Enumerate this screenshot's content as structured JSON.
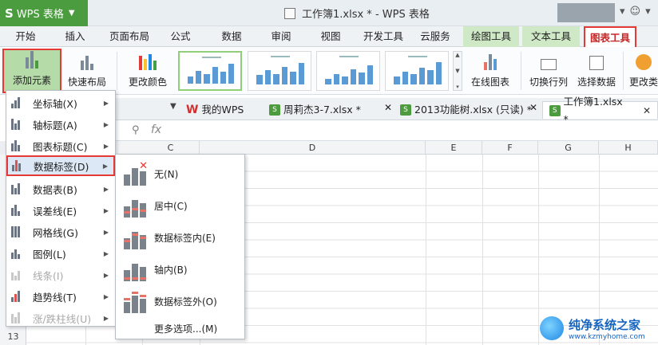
{
  "app": {
    "name": "WPS 表格",
    "logo": "S"
  },
  "title": {
    "document": "工作簿1.xlsx * - WPS 表格"
  },
  "menu_tabs": [
    {
      "label": "开始"
    },
    {
      "label": "插入"
    },
    {
      "label": "页面布局"
    },
    {
      "label": "公式"
    },
    {
      "label": "数据"
    },
    {
      "label": "审阅"
    },
    {
      "label": "视图"
    },
    {
      "label": "开发工具"
    },
    {
      "label": "云服务"
    },
    {
      "label": "绘图工具"
    },
    {
      "label": "文本工具"
    },
    {
      "label": "图表工具"
    }
  ],
  "active_tab": "图表工具",
  "ribbon": {
    "add_element": "添加元素",
    "quick_layout": "快速布局",
    "change_color": "更改颜色",
    "online_chart": "在线图表",
    "switch_row_col": "切换行列",
    "select_data": "选择数据",
    "change_type": "更改类"
  },
  "doc_tabs": [
    {
      "label": "我的WPS",
      "icon": "wps-icon",
      "closable": false
    },
    {
      "label": "周莉杰3-7.xlsx *",
      "icon": "spreadsheet-icon",
      "closable": true
    },
    {
      "label": "2013功能树.xlsx (只读) *",
      "icon": "spreadsheet-icon",
      "closable": true
    },
    {
      "label": "工作簿1.xlsx *",
      "icon": "spreadsheet-icon",
      "closable": true
    }
  ],
  "formula_bar": {
    "fx": "fx"
  },
  "columns": [
    "C",
    "D",
    "E",
    "F",
    "G",
    "H"
  ],
  "row_visible": "13",
  "add_element_menu": [
    {
      "label": "坐标轴(X)",
      "icon": "axis-icon",
      "submenu": true,
      "enabled": true
    },
    {
      "label": "轴标题(A)",
      "icon": "axis-title-icon",
      "submenu": true,
      "enabled": true
    },
    {
      "label": "图表标题(C)",
      "icon": "chart-title-icon",
      "submenu": true,
      "enabled": true
    },
    {
      "label": "数据标签(D)",
      "icon": "data-label-icon",
      "submenu": true,
      "enabled": true,
      "highlighted": true
    },
    {
      "label": "数据表(B)",
      "icon": "data-table-icon",
      "submenu": true,
      "enabled": true
    },
    {
      "label": "误差线(E)",
      "icon": "error-bar-icon",
      "submenu": true,
      "enabled": true
    },
    {
      "label": "网格线(G)",
      "icon": "gridline-icon",
      "submenu": true,
      "enabled": true
    },
    {
      "label": "图例(L)",
      "icon": "legend-icon",
      "submenu": true,
      "enabled": true
    },
    {
      "label": "线条(I)",
      "icon": "lines-icon",
      "submenu": true,
      "enabled": false
    },
    {
      "label": "趋势线(T)",
      "icon": "trendline-icon",
      "submenu": true,
      "enabled": true
    },
    {
      "label": "涨/跌柱线(U)",
      "icon": "updown-bars-icon",
      "submenu": true,
      "enabled": false
    }
  ],
  "data_label_submenu": [
    {
      "label": "无(N)",
      "icon": "no-label-icon"
    },
    {
      "label": "居中(C)",
      "icon": "center-label-icon"
    },
    {
      "label": "数据标签内(E)",
      "icon": "inside-end-label-icon"
    },
    {
      "label": "轴内(B)",
      "icon": "inside-base-label-icon"
    },
    {
      "label": "数据标签外(O)",
      "icon": "outside-end-label-icon"
    }
  ],
  "submenu_more": "更多选项...(M)",
  "watermark": {
    "title": "纯净系统之家",
    "url": "www.kzmyhome.com"
  },
  "colors": {
    "accent_green": "#4a9c3f",
    "highlight_red": "#e53935",
    "menu_hover": "#dce8f5"
  }
}
